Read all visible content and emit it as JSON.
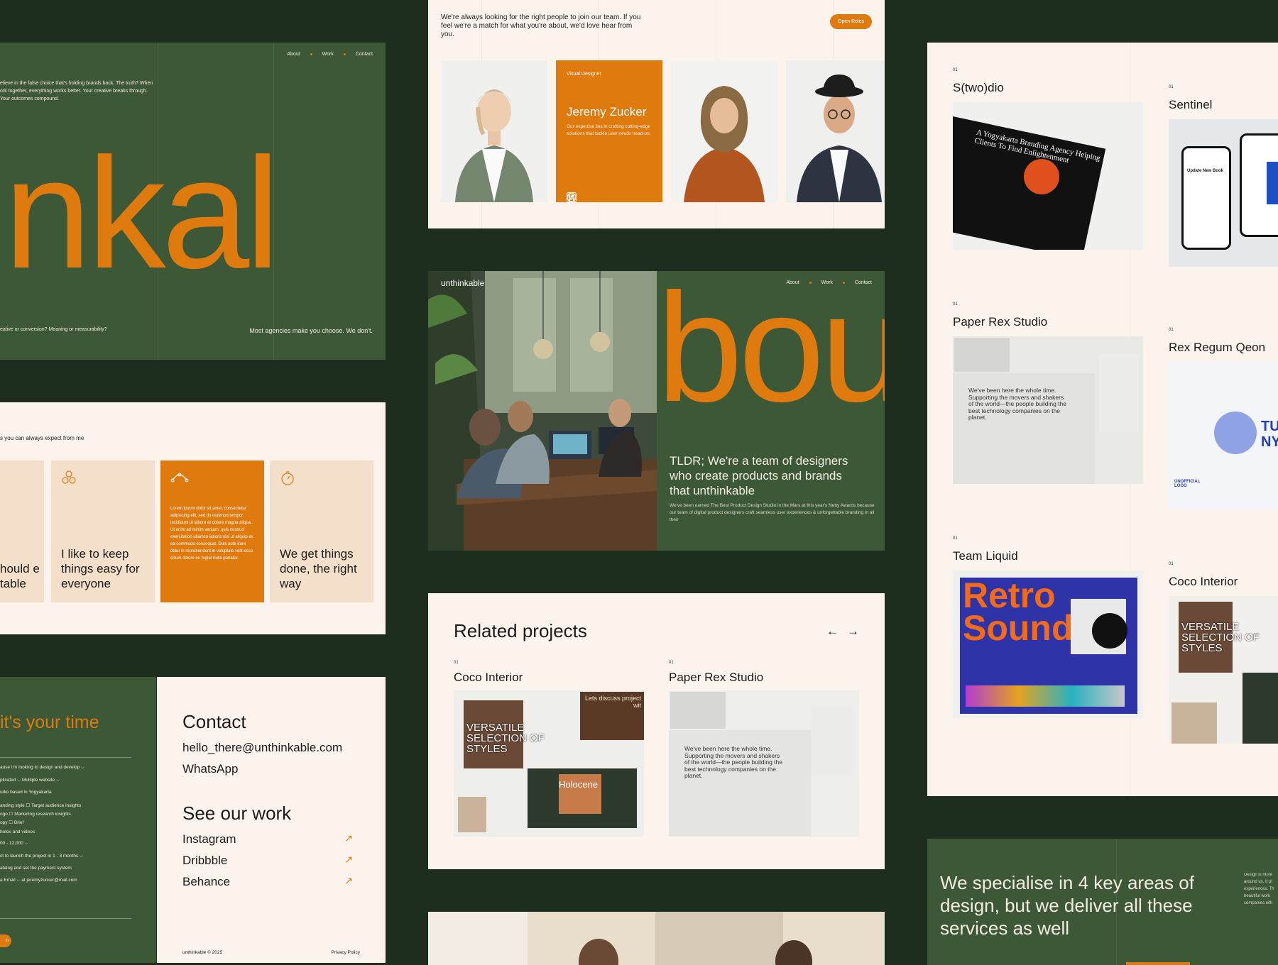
{
  "colors": {
    "bg": "#1e2e1e",
    "green": "#3c5836",
    "orange": "#df7a0e",
    "cream": "#fcf4ec"
  },
  "hero": {
    "nav": [
      "About",
      "Work",
      "Contact"
    ],
    "intro": "elieve in the false choice that's holding brands back. The truth? When ork together, everything works better. Your creative breaks through. Your outcomes compound.",
    "big_word": "inkal",
    "footer_left": "eative or conversion? Meaning or measurability?",
    "footer_right": "Most agencies make you choose. We don't."
  },
  "values": {
    "title": "s you can always expect from me",
    "cards": [
      {
        "text": "hould e table",
        "icon": ""
      },
      {
        "text": "I like to keep things easy for everyone",
        "icon": "circles-icon"
      },
      {
        "text": "",
        "body": "Lorem ipsum dolor sit amet, consectetur adipiscing elit, sed do eiusmod tempor incididunt ut labore et dolore magna aliqua. Ut enim ad minim veniam, quis nostrud exercitation ullamco laboris nisi ut aliquip ex ea commodo consequat. Duis aute irure dolor in reprehenderit in voluptate velit esse cillum dolore eu fugiat nulla pariatur.",
        "icon": "bezier-icon"
      },
      {
        "text": "We get things done, the right way",
        "icon": "stopwatch-icon"
      }
    ]
  },
  "contact": {
    "headline": "it's your time",
    "form": [
      "ause I'm looking   to design and develop ⌵",
      "plicated ⌵   Multiple website ⌵",
      "udio based in Yogyakarta",
      "anding style          ☐ Target audience insights",
      "ogo                       ☐ Marketing research insights",
      "opy                       ☐ Brief",
      "hotos and videos",
      "00 - 12,000 ⌵",
      "ct to launch the project in   1 - 3 months ⌵",
      "atalog and set the payment system",
      "a  Email ⌵   at   jeremyzucker@mail.com"
    ],
    "button": "n",
    "title": "Contact",
    "email": "hello_there@unthinkable.com",
    "whatsapp": "WhatsApp",
    "work_title": "See our work",
    "links": [
      "Instagram",
      "Dribbble",
      "Behance"
    ],
    "footer_left": "unthinkable © 2025",
    "footer_right": "Privacy Policy"
  },
  "team": {
    "intro": "We're always looking for the right people to join our team. If you feel we're a match for what you're about, we'd love hear from you.",
    "button": "Open Roles",
    "featured": {
      "role": "Visual Designer",
      "name": "Jeremy Zucker",
      "bio": "Our expertise lies in crafting cutting-edge solutions that tackle user needs head-on."
    }
  },
  "about": {
    "brand": "unthinkable",
    "nav": [
      "About",
      "Work",
      "Contact"
    ],
    "big_word": "bou",
    "tldr": "TLDR; We're a team of designers who create products and brands that unthinkable",
    "sub": "We've been earned The Best Product Design Studio in the Mars at this year's Netty Awards because our team of digital product designers craft seamless user experiences & unforgettable branding in all their"
  },
  "related": {
    "title": "Related projects",
    "projects": [
      {
        "num": "01",
        "name": "Coco Interior"
      },
      {
        "num": "01",
        "name": "Paper Rex Studio"
      }
    ],
    "coco_thumb": {
      "headline": "VERSATILE SELECTION OF STYLES",
      "card": "Lets discuss project wit",
      "holocene": "Holocene"
    },
    "paper_thumb": {
      "text": "We've been here the whole time. Supporting the movers and shakers of the world—the people building the best technology companies on the planet."
    }
  },
  "projects": [
    {
      "num": "01",
      "name": "S(two)dio",
      "thumb_text": "A Yogyakarta Branding Agency Helping Clients To Find Enlightenment"
    },
    {
      "num": "01",
      "name": "Sentinel",
      "thumb_text": "Update New Book"
    },
    {
      "num": "01",
      "name": "Paper Rex Studio",
      "thumb_text": "We've been here the whole time. Supporting the movers and shakers of the world—the people building the best technology companies on the planet."
    },
    {
      "num": "01",
      "name": "Rex Regum Qeon",
      "thumb_text": "TU NY",
      "badge": "UNOFFICIAL LOGO"
    },
    {
      "num": "01",
      "name": "Team Liquid",
      "thumb_text": "Retro Sound"
    },
    {
      "num": "01",
      "name": "Coco Interior",
      "thumb_text": "VERSATILE SELECTION OF STYLES"
    }
  ],
  "specialise": {
    "headline": "We specialise in 4 key areas of design, but we deliver all these services as well",
    "side": "Design is more around us. It pl experiences. Th beautiful work companies eith"
  }
}
